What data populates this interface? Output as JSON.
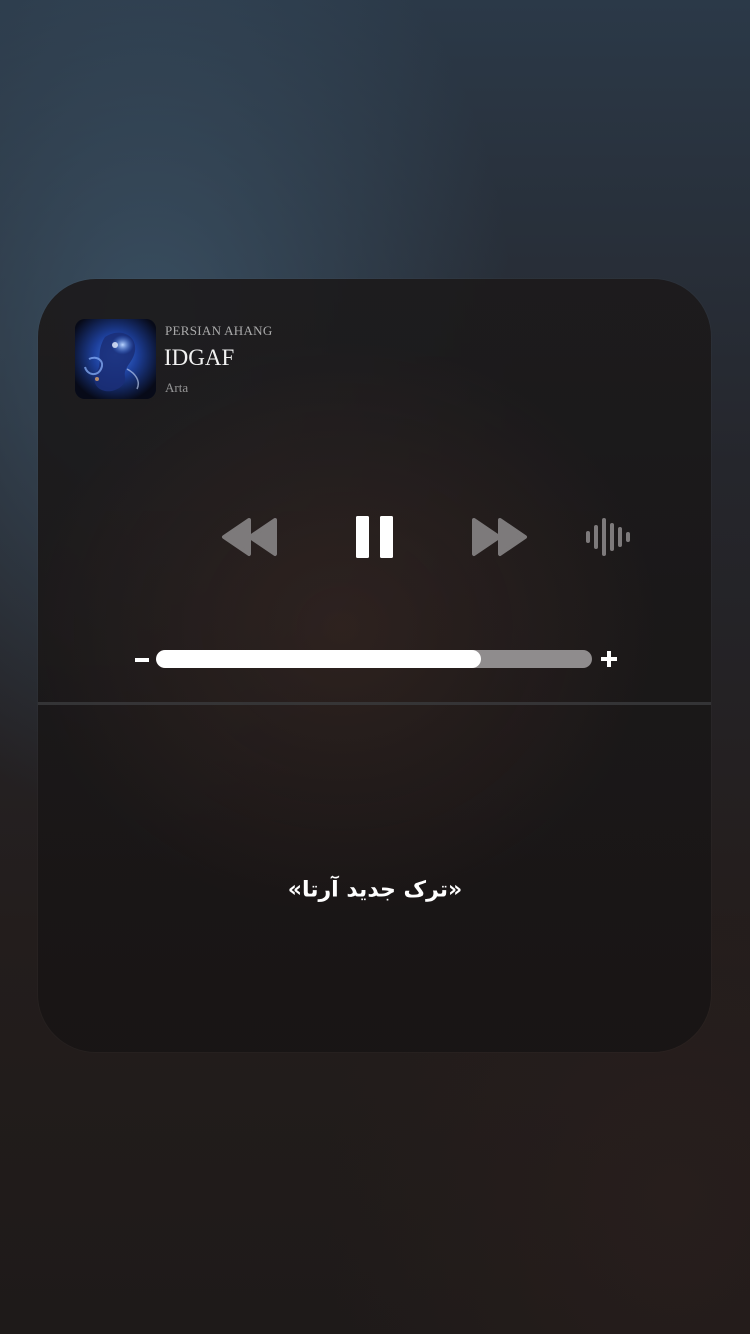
{
  "now_playing": {
    "source": "PERSIAN AHANG",
    "title": "IDGAF",
    "artist": "Arta",
    "artwork": "album-art-blue-figure"
  },
  "controls": {
    "rewind_icon": "rewind-icon",
    "pause_icon": "pause-icon",
    "forward_icon": "fast-forward-icon",
    "audio_output_icon": "waveform-icon"
  },
  "volume": {
    "minus_label": "-",
    "plus_label": "+",
    "level": 0.745
  },
  "caption": "«ترک جدید آرتا»",
  "colors": {
    "accent": "#ffffff",
    "controls_dim": "#7d7a7b",
    "track": "#969294"
  }
}
